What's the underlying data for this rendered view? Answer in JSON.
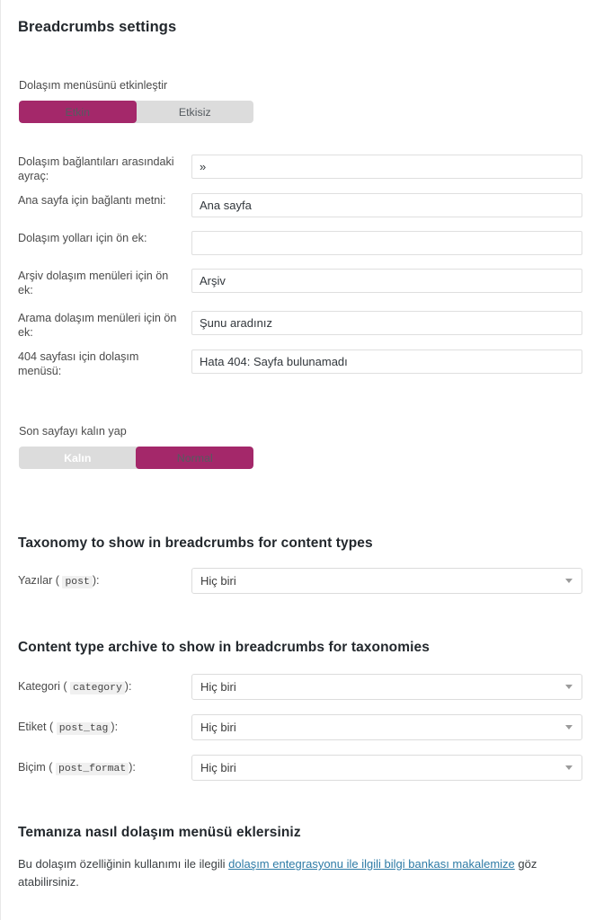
{
  "page": {
    "title": "Breadcrumbs settings"
  },
  "enable_menu": {
    "label": "Dolaşım menüsünü etkinleştir",
    "option_on": "Etkin",
    "option_off": "Etkisiz",
    "selected": "Etkin"
  },
  "fields": [
    {
      "label": "Dolaşım bağlantıları arasındaki ayraç:",
      "value": "»",
      "name": "separator-input"
    },
    {
      "label": "Ana sayfa için bağlantı metni:",
      "value": "Ana sayfa",
      "name": "home-link-text-input"
    },
    {
      "label": "Dolaşım yolları için ön ek:",
      "value": "",
      "name": "breadcrumbs-prefix-input"
    },
    {
      "label": "Arşiv dolaşım menüleri için ön ek:",
      "value": "Arşiv",
      "name": "archive-prefix-input"
    },
    {
      "label": "Arama dolaşım menüleri için ön ek:",
      "value": "Şunu aradınız",
      "name": "search-prefix-input"
    },
    {
      "label": "404 sayfası için dolaşım menüsü:",
      "value": "Hata 404: Sayfa bulunamadı",
      "name": "notfound-text-input"
    }
  ],
  "bold_last_page": {
    "label": "Son sayfayı kalın yap",
    "option_bold": "Kalın",
    "option_normal": "Normal",
    "selected": "Normal"
  },
  "taxonomy_section": {
    "title": "Taxonomy to show in breadcrumbs for content types",
    "rows": [
      {
        "label_before": "Yazılar (",
        "code": "post",
        "label_after": "):",
        "value": "Hiç biri"
      }
    ]
  },
  "content_type_section": {
    "title": "Content type archive to show in breadcrumbs for taxonomies",
    "rows": [
      {
        "label_before": "Kategori (",
        "code": "category",
        "label_after": "):",
        "value": "Hiç biri"
      },
      {
        "label_before": "Etiket (",
        "code": "post_tag",
        "label_after": "):",
        "value": "Hiç biri"
      },
      {
        "label_before": "Biçim (",
        "code": "post_format",
        "label_after": "):",
        "value": "Hiç biri"
      }
    ]
  },
  "howto": {
    "title": "Temanıza nasıl dolaşım menüsü eklersiniz",
    "text_before": "Bu dolaşım özelliğinin kullanımı ile ilegili ",
    "link_text": "dolaşım entegrasyonu ile ilgili bilgi bankası makalemize",
    "text_after": " göz atabilirsiniz."
  },
  "colors": {
    "accent": "#a4286a",
    "toggle_track": "#dcdcdc",
    "link": "#2e7ba6",
    "border": "#dfdfdf"
  }
}
